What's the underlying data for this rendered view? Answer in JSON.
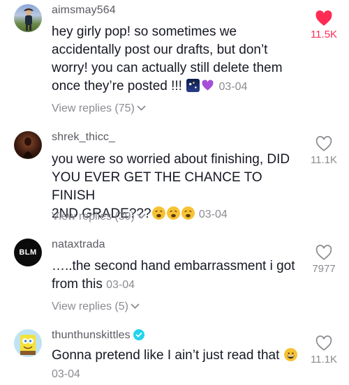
{
  "comments": [
    {
      "username": "aimsmay564",
      "text": "hey girly pop! so sometimes we accidentally post our drafts, but don’t worry! you can actually still delete them once they’re posted !!!",
      "date": "03-04",
      "likes": "11.5K",
      "liked": true,
      "replies": "View replies (75)",
      "avatar_icon": "person-photo-avatar",
      "emoji": [
        "night-sky-emoji",
        "purple-heart-emoji"
      ]
    },
    {
      "username": "shrek_thicc_",
      "text_lines": [
        "you were so worried about finishing, DID",
        "YOU EVER GET THE CHANCE TO FINISH",
        "2ND GRADE???"
      ],
      "date": "03-04",
      "likes": "11.1K",
      "liked": false,
      "replies": "View replies (39)",
      "avatar_icon": "dark-photo-avatar",
      "emoji": [
        "weary-face-emoji",
        "weary-face-emoji",
        "weary-face-emoji"
      ]
    },
    {
      "username": "nataxtrada",
      "avatar_text": "BLM",
      "text_line1": "…..the second hand embarrassment i got",
      "text_line2": "from this",
      "date": "03-04",
      "likes": "7977",
      "liked": false,
      "replies": "View replies (5)"
    },
    {
      "username": "thunthunskittles",
      "verified": true,
      "text": "Gonna pretend like I ain’t just read that",
      "date": "03-04",
      "likes": "11.1K",
      "liked": false,
      "avatar_icon": "spongebob-avatar",
      "emoji": [
        "grinning-face-emoji"
      ]
    }
  ],
  "colors": {
    "liked": "#fe2c55",
    "muted": "#8a8b91",
    "text": "#161823"
  }
}
